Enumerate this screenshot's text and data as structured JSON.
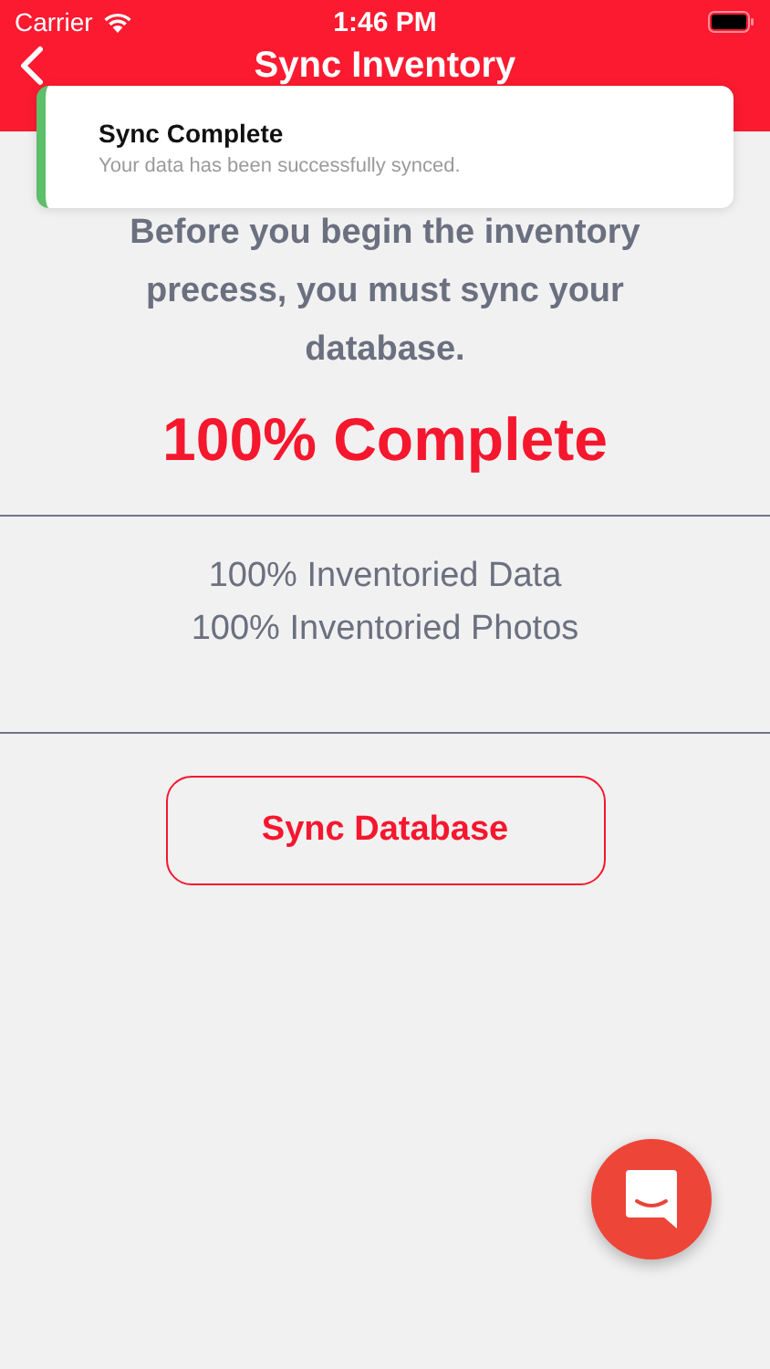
{
  "status_bar": {
    "carrier": "Carrier",
    "time": "1:46 PM"
  },
  "nav_bar": {
    "title": "Sync Inventory"
  },
  "toast": {
    "title": "Sync Complete",
    "message": "Your data has been successfully synced.",
    "color": "#5cbf6a"
  },
  "intro": "Before you begin the inventory precess, you must sync your database.",
  "progress": "100% Complete",
  "stats": [
    "100% Inventoried Data",
    "100% Inventoried Photos"
  ],
  "sync_button": "Sync Database"
}
